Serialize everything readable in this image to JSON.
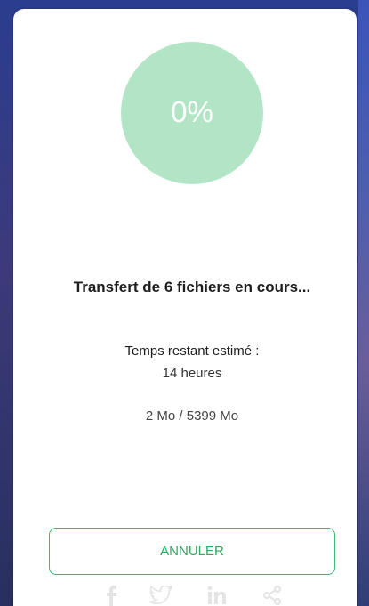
{
  "progress": {
    "percent_label": "0%",
    "fraction": 0.0
  },
  "transfer": {
    "title": "Transfert de 6 fichiers en cours...",
    "eta_label": "Temps restant estimé :",
    "eta_value": "14 heures",
    "size_progress": "2 Mo / 5399 Mo"
  },
  "actions": {
    "cancel_label": "ANNULER"
  },
  "share": {
    "icons": [
      "facebook-icon",
      "twitter-icon",
      "linkedin-icon",
      "share-icon"
    ]
  },
  "colors": {
    "accent": "#3dba6c",
    "accent_light": "#b2e5c6",
    "button_text": "#2fa75d"
  }
}
